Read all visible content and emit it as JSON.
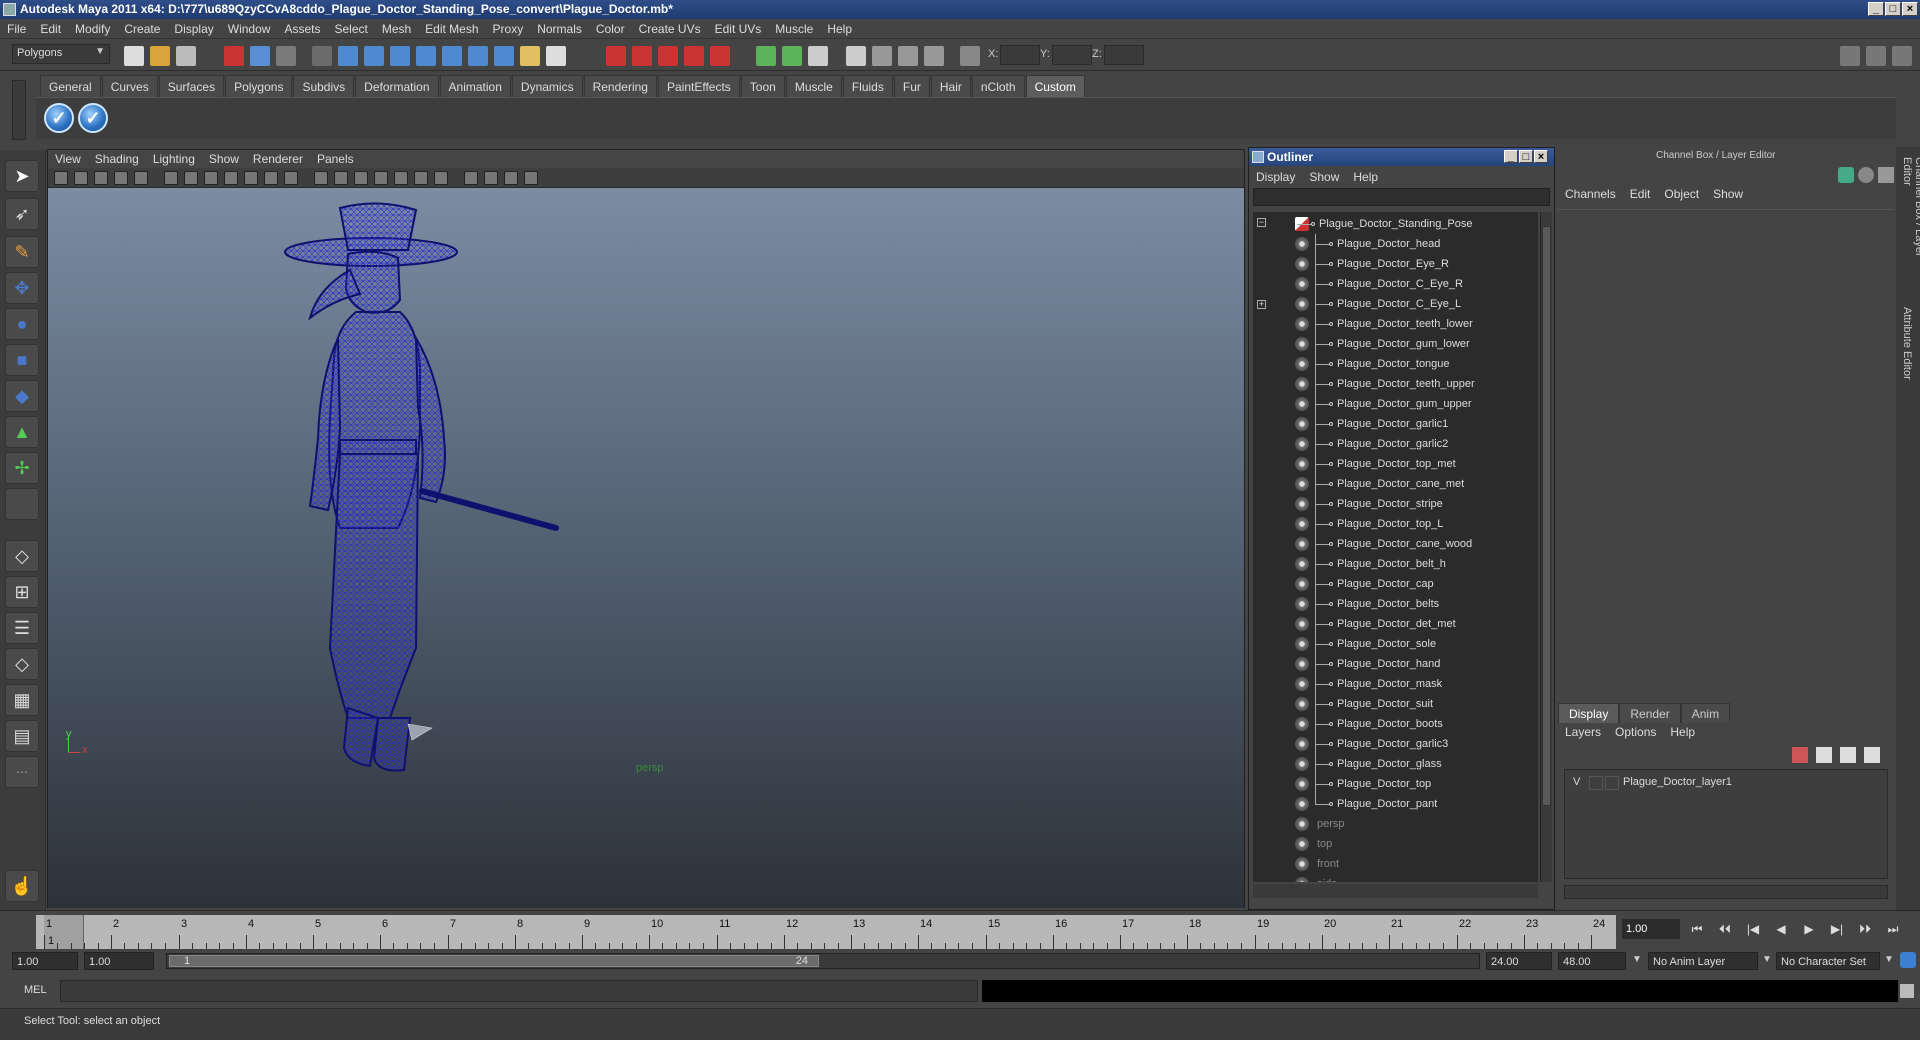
{
  "window": {
    "title": "Autodesk Maya 2011 x64: D:\\777\\u689QzyCCvA8cddo_Plague_Doctor_Standing_Pose_convert\\Plague_Doctor.mb*",
    "minimize": "_",
    "maximize": "□",
    "close": "×"
  },
  "menubar": [
    "File",
    "Edit",
    "Modify",
    "Create",
    "Display",
    "Window",
    "Assets",
    "Select",
    "Mesh",
    "Edit Mesh",
    "Proxy",
    "Normals",
    "Color",
    "Create UVs",
    "Edit UVs",
    "Muscle",
    "Help"
  ],
  "statusline": {
    "mode": "Polygons",
    "x_label": "X:",
    "y_label": "Y:",
    "z_label": "Z:"
  },
  "shelf": {
    "tabs": [
      "General",
      "Curves",
      "Surfaces",
      "Polygons",
      "Subdivs",
      "Deformation",
      "Animation",
      "Dynamics",
      "Rendering",
      "PaintEffects",
      "Toon",
      "Muscle",
      "Fluids",
      "Fur",
      "Hair",
      "nCloth",
      "Custom"
    ],
    "active_tab": "Custom"
  },
  "viewport": {
    "menus": [
      "View",
      "Shading",
      "Lighting",
      "Show",
      "Renderer",
      "Panels"
    ],
    "camera": "persp",
    "axis_y": "y",
    "axis_x": "x",
    "wire_color": "#14148c"
  },
  "outliner": {
    "title": "Outliner",
    "menus": [
      "Display",
      "Show",
      "Help"
    ],
    "root": "Plague_Doctor_Standing_Pose",
    "items": [
      "Plague_Doctor_head",
      "Plague_Doctor_Eye_R",
      "Plague_Doctor_C_Eye_R",
      "Plague_Doctor_C_Eye_L",
      "Plague_Doctor_teeth_lower",
      "Plague_Doctor_gum_lower",
      "Plague_Doctor_tongue",
      "Plague_Doctor_teeth_upper",
      "Plague_Doctor_gum_upper",
      "Plague_Doctor_garlic1",
      "Plague_Doctor_garlic2",
      "Plague_Doctor_top_met",
      "Plague_Doctor_cane_met",
      "Plague_Doctor_stripe",
      "Plague_Doctor_top_L",
      "Plague_Doctor_cane_wood",
      "Plague_Doctor_belt_h",
      "Plague_Doctor_cap",
      "Plague_Doctor_belts",
      "Plague_Doctor_det_met",
      "Plague_Doctor_sole",
      "Plague_Doctor_hand",
      "Plague_Doctor_mask",
      "Plague_Doctor_suit",
      "Plague_Doctor_boots",
      "Plague_Doctor_garlic3",
      "Plague_Doctor_glass",
      "Plague_Doctor_top",
      "Plague_Doctor_pant"
    ],
    "cameras": [
      "persp",
      "top",
      "front",
      "side"
    ]
  },
  "channelbox": {
    "header": "Channel Box / Layer Editor",
    "menus": [
      "Channels",
      "Edit",
      "Object",
      "Show"
    ],
    "layer_tabs": [
      "Display",
      "Render",
      "Anim"
    ],
    "active_layer_tab": "Display",
    "layer_menus": [
      "Layers",
      "Options",
      "Help"
    ],
    "layer": {
      "visible": "V",
      "name": "Plague_Doctor_layer1"
    },
    "side_tab_1": "Channel Box / Layer Editor",
    "side_tab_2": "Attribute Editor"
  },
  "timeslider": {
    "ticks": [
      "1",
      "2",
      "3",
      "4",
      "5",
      "6",
      "7",
      "8",
      "9",
      "10",
      "11",
      "12",
      "13",
      "14",
      "15",
      "16",
      "17",
      "18",
      "19",
      "20",
      "21",
      "22",
      "23",
      "24"
    ],
    "current_marker": "1",
    "current_frame": "1.00",
    "playback": [
      "⏮",
      "⏴⏴",
      "|◀",
      "◀",
      "▶",
      "▶|",
      "⏵⏵",
      "⏭"
    ]
  },
  "rangeslider": {
    "start": "1.00",
    "anim_start": "1.00",
    "range_start": "1",
    "range_end": "24",
    "end": "24.00",
    "anim_end": "48.00",
    "anim_layer": "No Anim Layer",
    "char_set": "No Character Set"
  },
  "cmdline": {
    "label": "MEL"
  },
  "helpline": {
    "text": "Select Tool: select an object"
  }
}
